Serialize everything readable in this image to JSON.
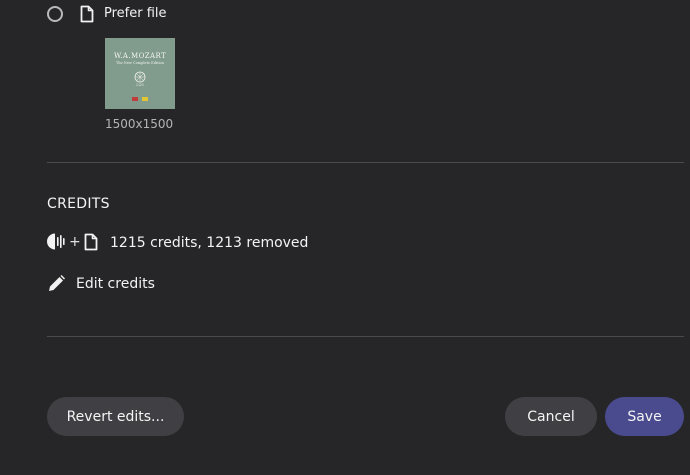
{
  "cover_art": {
    "option_label": "Prefer file",
    "album": {
      "artist": "W.A.MOZART",
      "subtitle": "The New Complete Edition",
      "number": "225"
    },
    "dimensions": "1500x1500"
  },
  "credits": {
    "section_title": "CREDITS",
    "summary": "1215 credits, 1213 removed",
    "plus": "+",
    "edit_label": "Edit credits"
  },
  "actions": {
    "revert_label": "Revert edits...",
    "cancel_label": "Cancel",
    "save_label": "Save"
  },
  "colors": {
    "background": "#262628",
    "accent": "#4a4b8e",
    "secondary_button": "#404044",
    "divider": "#4b4b4e"
  },
  "icons": {
    "prefer_file": "file-icon",
    "credits_source_audio": "audio-file-icon",
    "credits_source_file": "file-icon",
    "edit": "pencil-icon"
  }
}
